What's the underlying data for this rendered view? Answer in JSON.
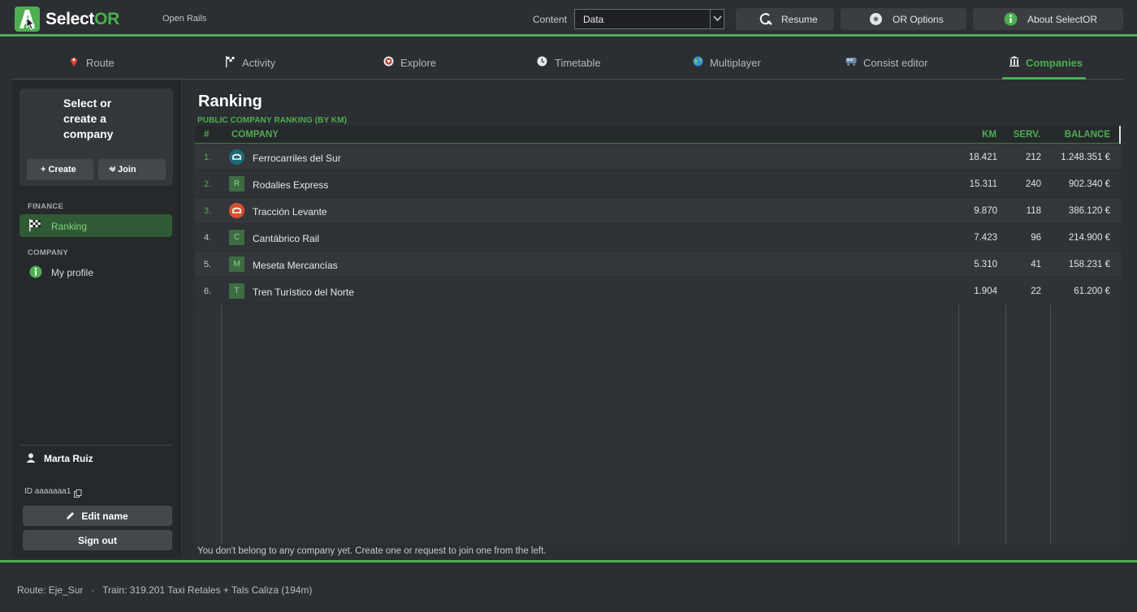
{
  "app": {
    "title_main": "Select",
    "title_accent": "OR",
    "subtitle": "Open Rails"
  },
  "header": {
    "content_label": "Content",
    "content_value": "Data",
    "resume_label": "Resume",
    "options_label": "OR Options",
    "about_label": "About SelectOR"
  },
  "tabs": [
    {
      "label": "Route",
      "icon": "pin-icon"
    },
    {
      "label": "Activity",
      "icon": "flag-icon"
    },
    {
      "label": "Explore",
      "icon": "compass-icon"
    },
    {
      "label": "Timetable",
      "icon": "clock-icon"
    },
    {
      "label": "Multiplayer",
      "icon": "globe-icon"
    },
    {
      "label": "Consist editor",
      "icon": "train-icon"
    },
    {
      "label": "Companies",
      "icon": "building-icon",
      "active": true
    }
  ],
  "sidebar": {
    "card_title_lines": [
      "Select or",
      "create a",
      "company"
    ],
    "create_label": "+ Create",
    "join_label": "Join",
    "finance_heading": "FINANCE",
    "ranking_label": "Ranking",
    "company_heading": "COMPANY",
    "profile_label": "My profile",
    "user_name": "Marta Ruiz",
    "user_id": "ID aaaaaaa1",
    "edit_name_label": "Edit name",
    "sign_out_label": "Sign out"
  },
  "main": {
    "title": "Ranking",
    "subtitle": "PUBLIC COMPANY RANKING (BY KM)",
    "columns": {
      "rank": "#",
      "company": "COMPANY",
      "km": "KM",
      "serv": "SERV.",
      "balance": "BALANCE"
    },
    "rows": [
      {
        "rank": "1.",
        "name": "Ferrocarriles del Sur",
        "km": "18.421",
        "serv": "212",
        "balance": "1.248.351 €",
        "avatar": "logo",
        "avatar_color": "#1f6a78"
      },
      {
        "rank": "2.",
        "name": "Rodalies Express",
        "km": "15.311",
        "serv": "240",
        "balance": "902.340 €",
        "avatar": "R"
      },
      {
        "rank": "3.",
        "name": "Tracción Levante",
        "km": "9.870",
        "serv": "118",
        "balance": "386.120 €",
        "avatar": "logo",
        "avatar_color": "#d9502e"
      },
      {
        "rank": "4.",
        "name": "Cantábrico Rail",
        "km": "7.423",
        "serv": "96",
        "balance": "214.900 €",
        "avatar": "C"
      },
      {
        "rank": "5.",
        "name": "Meseta Mercancías",
        "km": "5.310",
        "serv": "41",
        "balance": "158.231 €",
        "avatar": "M"
      },
      {
        "rank": "6.",
        "name": "Tren Turístico del Norte",
        "km": "1.904",
        "serv": "22",
        "balance": "61.200 €",
        "avatar": "T"
      }
    ],
    "note": "You don't belong to any company yet. Create one or request to join one from the left."
  },
  "footer": {
    "status": "Route: Eje_Sur   ·   Train: 319.201 Taxi Retales + Tals Caliza (194m)"
  },
  "colors": {
    "accent": "#4caf50",
    "rank_top": "#4caf50",
    "rank_rest": "#c8cacc"
  }
}
